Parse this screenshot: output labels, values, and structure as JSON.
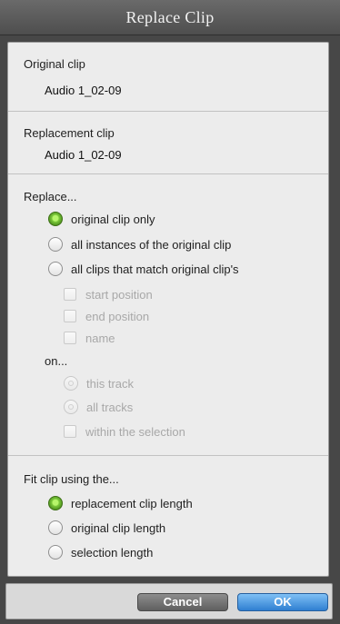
{
  "window": {
    "title": "Replace Clip"
  },
  "original": {
    "label": "Original clip",
    "value": "Audio 1_02-09"
  },
  "replacement": {
    "label": "Replacement clip",
    "value": "Audio 1_02-09"
  },
  "replace": {
    "label": "Replace...",
    "options": [
      {
        "label": "original clip only",
        "checked": true
      },
      {
        "label": "all instances of the original clip",
        "checked": false
      },
      {
        "label": "all clips that match original clip's",
        "checked": false
      }
    ],
    "match": [
      {
        "label": "start position",
        "checked": false
      },
      {
        "label": "end position",
        "checked": false
      },
      {
        "label": "name",
        "checked": false
      }
    ]
  },
  "on": {
    "label": "on...",
    "options": [
      {
        "label": "this track",
        "checked": false
      },
      {
        "label": "all tracks",
        "checked": false
      }
    ],
    "within_label": "within the selection"
  },
  "fit": {
    "label": "Fit clip using the...",
    "options": [
      {
        "label": "replacement clip length",
        "checked": true
      },
      {
        "label": "original clip length",
        "checked": false
      },
      {
        "label": "selection length",
        "checked": false
      }
    ]
  },
  "buttons": {
    "cancel": "Cancel",
    "ok": "OK"
  }
}
